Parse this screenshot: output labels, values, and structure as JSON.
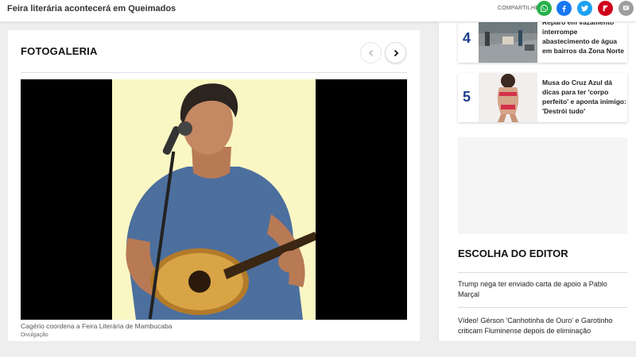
{
  "topbar": {
    "article_title": "Feira literária acontecerá em Queimados",
    "share_label": "COMPARTILHE",
    "share_buttons": [
      {
        "name": "whatsapp",
        "icon": "whatsapp-icon",
        "color": "#25b14b"
      },
      {
        "name": "facebook",
        "icon": "facebook-icon",
        "color": "#1877f2"
      },
      {
        "name": "twitter",
        "icon": "twitter-icon",
        "color": "#1da1f2"
      },
      {
        "name": "flipboard",
        "icon": "flipboard-icon",
        "color": "#d0021b"
      },
      {
        "name": "comments",
        "icon": "comment-icon",
        "color": "#9e9e9e"
      }
    ]
  },
  "gallery": {
    "title": "FOTOGALERIA",
    "prev_icon": "chevron-left-icon",
    "next_icon": "chevron-right-icon",
    "caption": "Cagério coordena a Feira Literária de Mambucaba",
    "credit": "Divulgação"
  },
  "most_read": [
    {
      "rank": "4",
      "text": "Reparo em vazamento interrompe abastecimento de água em bairros da Zona Norte"
    },
    {
      "rank": "5",
      "text": "Musa do Cruz Azul dá dicas para ter 'corpo perfeito' e aponta inimigo: 'Destrói tudo'"
    }
  ],
  "editor": {
    "title": "ESCOLHA DO EDITOR",
    "items": [
      "Trump nega ter enviado carta de apoio a Pablo Marçal",
      "Vídeo! Gérson 'Canhotinha de Ouro' e Garotinho criticam Fluminense depois de eliminação"
    ]
  },
  "colors": {
    "accent_number": "#1d3f8f",
    "photo_background": "#faf7c4"
  }
}
